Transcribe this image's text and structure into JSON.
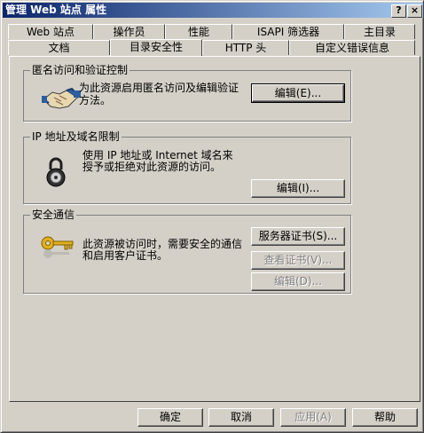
{
  "window": {
    "title": "管理 Web 站点 属性"
  },
  "title_buttons": {
    "help": "?",
    "close": "×"
  },
  "tabs_row1": [
    "Web 站点",
    "操作员",
    "性能",
    "ISAPI 筛选器",
    "主目录"
  ],
  "tabs_row2": [
    "文档",
    "目录安全性",
    "HTTP 头",
    "自定义错误信息"
  ],
  "active_tab": "目录安全性",
  "anonymous": {
    "title": "匿名访问和验证控制",
    "line1": "为此资源启用匿名访问及编辑验证",
    "line2": "方法。",
    "edit_button": "编辑(E)..."
  },
  "ip": {
    "title": "IP 地址及域名限制",
    "line1": "使用 IP 地址或 Internet 域名来",
    "line2": "授予或拒绝对此资源的访问。",
    "edit_button": "编辑(I)..."
  },
  "secure": {
    "title": "安全通信",
    "line1": "此资源被访问时，需要安全的通信",
    "line2": "和启用客户证书。",
    "server_cert_button": "服务器证书(S)...",
    "view_cert_button": "查看证书(V)...",
    "edit_button": "编辑(D)..."
  },
  "footer": {
    "ok": "确定",
    "cancel": "取消",
    "apply": "应用(A)",
    "help": "帮助"
  },
  "icons": {
    "anonymous": "handshake-icon",
    "ip": "padlock-icon",
    "secure": "key-icon"
  }
}
